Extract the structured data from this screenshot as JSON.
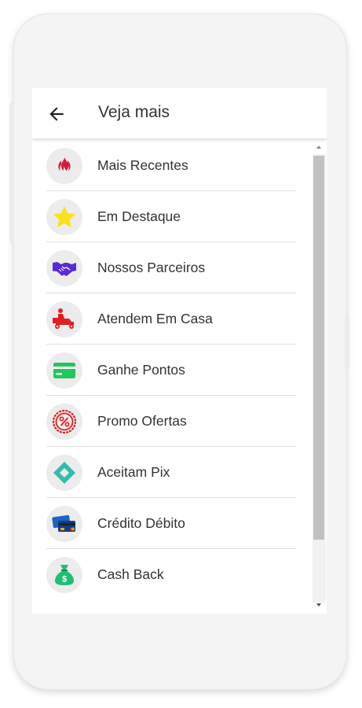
{
  "appbar": {
    "title": "Veja mais",
    "back_icon": "arrow-left-icon"
  },
  "items": [
    {
      "label": "Mais Recentes",
      "icon": "flame-icon",
      "color": "#d81b3c"
    },
    {
      "label": "Em Destaque",
      "icon": "star-icon",
      "color": "#fbe11a"
    },
    {
      "label": "Nossos Parceiros",
      "icon": "handshake-icon",
      "color": "#5b2bd8"
    },
    {
      "label": "Atendem Em Casa",
      "icon": "delivery-scooter-icon",
      "color": "#e02020"
    },
    {
      "label": "Ganhe Pontos",
      "icon": "card-icon",
      "color": "#22c55e"
    },
    {
      "label": "Promo Ofertas",
      "icon": "percent-badge-icon",
      "color": "#e02020"
    },
    {
      "label": "Aceitam Pix",
      "icon": "pix-icon",
      "color": "#32bcad"
    },
    {
      "label": "Crédito Débito",
      "icon": "credit-cards-icon",
      "color": "#1e63c4"
    },
    {
      "label": "Cash Back",
      "icon": "money-bag-icon",
      "color": "#1fbf73"
    }
  ]
}
